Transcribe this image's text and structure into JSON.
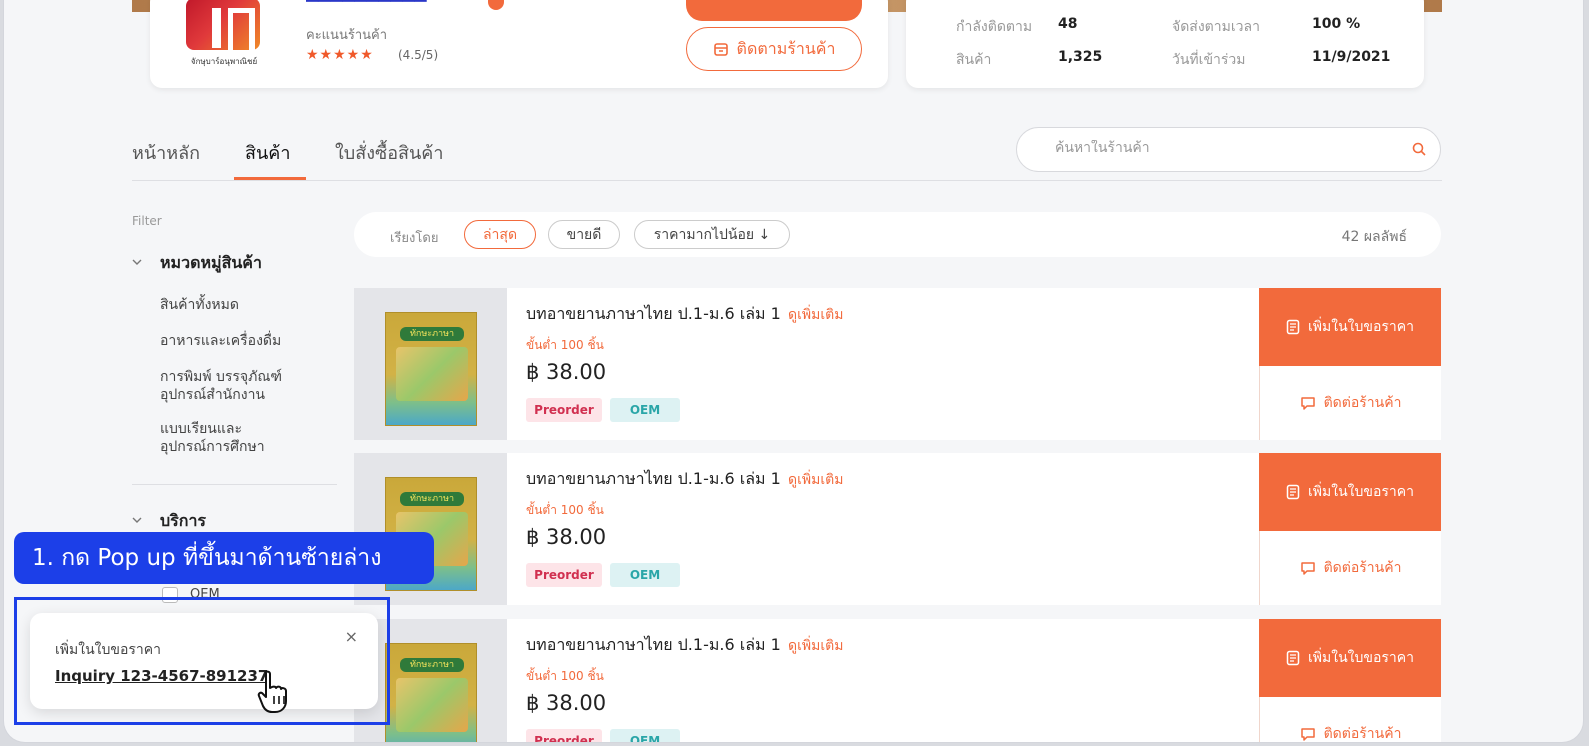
{
  "shop": {
    "logo_text": "จักษุบาร์อนุพาณิชย์",
    "rating_label": "คะแนนร้านค้า",
    "stars": "★★★★★",
    "rating_value": "(4.5/5)",
    "follow_button": "ติดตามร้านค้า"
  },
  "stats": {
    "followers_label": "กำลังติดตาม",
    "followers_value": "48",
    "ontime_label": "จัดส่งตามเวลา",
    "ontime_value": "100 %",
    "products_label": "สินค้า",
    "products_value": "1,325",
    "joined_label": "วันที่เข้าร่วม",
    "joined_value": "11/9/2021"
  },
  "tabs": [
    {
      "label": "หน้าหลัก",
      "active": false
    },
    {
      "label": "สินค้า",
      "active": true
    },
    {
      "label": "ใบสั่งซื้อสินค้า",
      "active": false
    }
  ],
  "search": {
    "placeholder": "ค้นหาในร้านค้า"
  },
  "sidebar": {
    "filter_label": "Filter",
    "category_title": "หมวดหมู่สินค้า",
    "categories": [
      "สินค้าทั้งหมด",
      "อาหารและเครื่องดื่ม",
      "การพิมพ์ บรรจุภัณฑ์\nอุปกรณ์สำนักงาน",
      "แบบเรียนและ\nอุปกรณ์การศึกษา"
    ],
    "service_title": "บริการ",
    "service_option": "OEM"
  },
  "sort": {
    "label": "เรียงโดย",
    "options": [
      {
        "label": "ล่าสุด",
        "active": true
      },
      {
        "label": "ขายดี",
        "active": false
      },
      {
        "label": "ราคามากไปน้อย ↓",
        "active": false
      }
    ],
    "results": "42  ผลลัพธ์"
  },
  "products": [
    {
      "title": "บทอาขยานภาษาไทย ป.1-ม.6 เล่ม 1",
      "more": "ดูเพิ่มเติม",
      "min": "ขั้นต่ำ 100 ชิ้น",
      "price": "฿ 38.00",
      "tags": [
        "Preorder",
        "OEM"
      ],
      "book_title": "ทักษะภาษา"
    },
    {
      "title": "บทอาขยานภาษาไทย ป.1-ม.6 เล่ม 1",
      "more": "ดูเพิ่มเติม",
      "min": "ขั้นต่ำ 100 ชิ้น",
      "price": "฿ 38.00",
      "tags": [
        "Preorder",
        "OEM"
      ],
      "book_title": "ทักษะภาษา"
    },
    {
      "title": "บทอาขยานภาษาไทย ป.1-ม.6 เล่ม 1",
      "more": "ดูเพิ่มเติม",
      "min": "ขั้นต่ำ 100 ชิ้น",
      "price": "฿ 38.00",
      "tags": [
        "Preorder",
        "OEM"
      ],
      "book_title": "ทักษะภาษา"
    }
  ],
  "actions": {
    "quote": "เพิ่มในใบขอราคา",
    "contact": "ติดต่อร้านค้า"
  },
  "step_label": "1. กด Pop up ที่ขึ้นมาด้านซ้ายล่าง",
  "toast": {
    "title": "เพิ่มในใบขอราคา",
    "link": "Inquiry 123-4567-891237",
    "close": "×"
  },
  "colors": {
    "accent": "#f26a3c",
    "annotation": "#1c3fe8",
    "shop_name": "#2a37c8"
  }
}
